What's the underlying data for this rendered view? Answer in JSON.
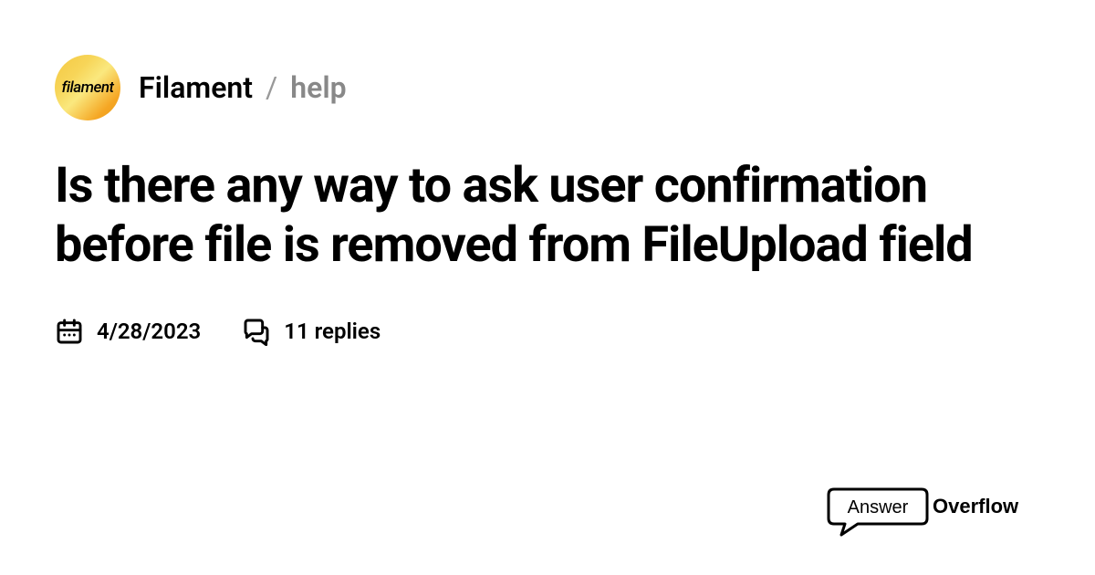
{
  "avatar": {
    "text": "filament"
  },
  "breadcrumb": {
    "community": "Filament",
    "separator": "/",
    "channel": "help"
  },
  "title": "Is there any way to ask user confirmation before file is removed from FileUpload field",
  "meta": {
    "date": "4/28/2023",
    "replies": "11 replies"
  },
  "logo": {
    "text_left": "Answer",
    "text_right": "Overflow"
  }
}
